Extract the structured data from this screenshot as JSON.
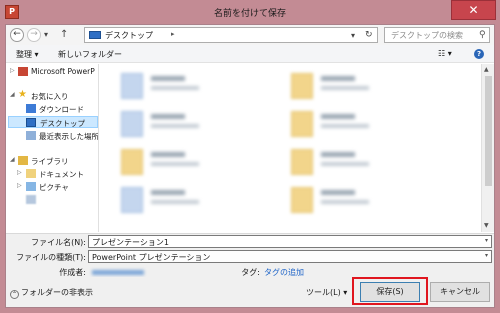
{
  "window": {
    "title": "名前を付けて保存",
    "app_icon_letter": "P",
    "close_glyph": "✕"
  },
  "address": {
    "back_glyph": "←",
    "forward_glyph": "→",
    "recent_glyph": "▾",
    "up_glyph": "↑",
    "path": "デスクトップ",
    "path_chevron": "▸",
    "dropdown_glyph": "▾",
    "refresh_glyph": "↻",
    "search_placeholder": "デスクトップの検索",
    "search_glyph": "⚲"
  },
  "toolbar": {
    "organize": "整理 ▾",
    "new_folder": "新しいフォルダー",
    "view_glyph": "☷ ▾",
    "help_glyph": "?"
  },
  "nav": {
    "items": [
      {
        "label": "Microsoft PowerP",
        "arrow": "▷"
      },
      {
        "label": "お気に入り",
        "arrow": "◢"
      },
      {
        "label": "ダウンロード",
        "arrow": ""
      },
      {
        "label": "デスクトップ",
        "arrow": ""
      },
      {
        "label": "最近表示した場所",
        "arrow": ""
      },
      {
        "label": "ライブラリ",
        "arrow": "◢"
      },
      {
        "label": "ドキュメント",
        "arrow": "▷"
      },
      {
        "label": "ピクチャ",
        "arrow": "▷"
      }
    ]
  },
  "scrollbar": {
    "up": "▲",
    "down": "▼"
  },
  "form": {
    "filename_label": "ファイル名(N):",
    "filename_value": "プレゼンテーション1",
    "filetype_label": "ファイルの種類(T):",
    "filetype_value": "PowerPoint プレゼンテーション",
    "author_label": "作成者:",
    "tag_label": "タグ:",
    "tag_link": "タグの追加",
    "dropdown_glyph": "▾"
  },
  "footer": {
    "hide_folders_icon": "⌃",
    "hide_folders": "フォルダーの非表示",
    "tools": "ツール(L)  ▾",
    "save": "保存(S)",
    "cancel": "キャンセル"
  },
  "colors": {
    "title_bar": "#c38b94",
    "close_button": "#c7454d",
    "highlight": "#e0161f",
    "link": "#1e64c8"
  }
}
